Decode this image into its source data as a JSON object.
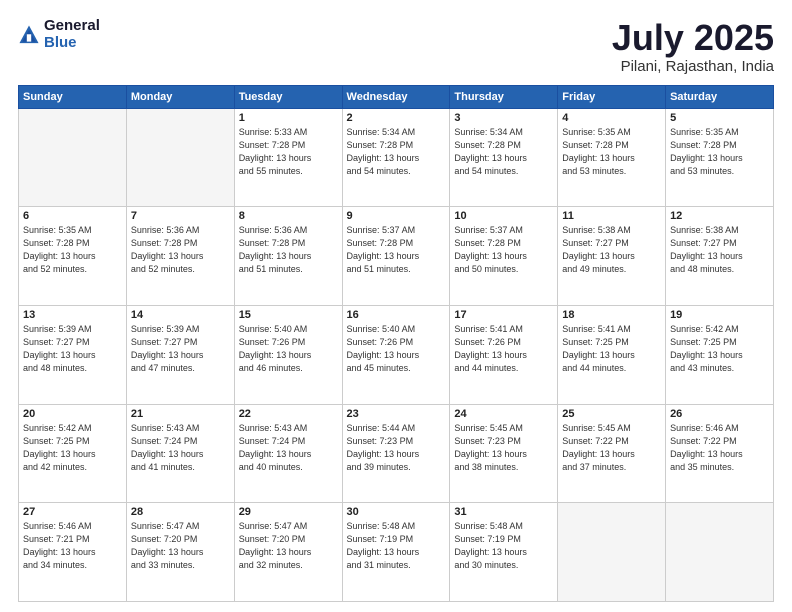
{
  "logo": {
    "general": "General",
    "blue": "Blue"
  },
  "title": {
    "month": "July 2025",
    "location": "Pilani, Rajasthan, India"
  },
  "headers": [
    "Sunday",
    "Monday",
    "Tuesday",
    "Wednesday",
    "Thursday",
    "Friday",
    "Saturday"
  ],
  "weeks": [
    [
      {
        "day": "",
        "detail": ""
      },
      {
        "day": "",
        "detail": ""
      },
      {
        "day": "1",
        "detail": "Sunrise: 5:33 AM\nSunset: 7:28 PM\nDaylight: 13 hours\nand 55 minutes."
      },
      {
        "day": "2",
        "detail": "Sunrise: 5:34 AM\nSunset: 7:28 PM\nDaylight: 13 hours\nand 54 minutes."
      },
      {
        "day": "3",
        "detail": "Sunrise: 5:34 AM\nSunset: 7:28 PM\nDaylight: 13 hours\nand 54 minutes."
      },
      {
        "day": "4",
        "detail": "Sunrise: 5:35 AM\nSunset: 7:28 PM\nDaylight: 13 hours\nand 53 minutes."
      },
      {
        "day": "5",
        "detail": "Sunrise: 5:35 AM\nSunset: 7:28 PM\nDaylight: 13 hours\nand 53 minutes."
      }
    ],
    [
      {
        "day": "6",
        "detail": "Sunrise: 5:35 AM\nSunset: 7:28 PM\nDaylight: 13 hours\nand 52 minutes."
      },
      {
        "day": "7",
        "detail": "Sunrise: 5:36 AM\nSunset: 7:28 PM\nDaylight: 13 hours\nand 52 minutes."
      },
      {
        "day": "8",
        "detail": "Sunrise: 5:36 AM\nSunset: 7:28 PM\nDaylight: 13 hours\nand 51 minutes."
      },
      {
        "day": "9",
        "detail": "Sunrise: 5:37 AM\nSunset: 7:28 PM\nDaylight: 13 hours\nand 51 minutes."
      },
      {
        "day": "10",
        "detail": "Sunrise: 5:37 AM\nSunset: 7:28 PM\nDaylight: 13 hours\nand 50 minutes."
      },
      {
        "day": "11",
        "detail": "Sunrise: 5:38 AM\nSunset: 7:27 PM\nDaylight: 13 hours\nand 49 minutes."
      },
      {
        "day": "12",
        "detail": "Sunrise: 5:38 AM\nSunset: 7:27 PM\nDaylight: 13 hours\nand 48 minutes."
      }
    ],
    [
      {
        "day": "13",
        "detail": "Sunrise: 5:39 AM\nSunset: 7:27 PM\nDaylight: 13 hours\nand 48 minutes."
      },
      {
        "day": "14",
        "detail": "Sunrise: 5:39 AM\nSunset: 7:27 PM\nDaylight: 13 hours\nand 47 minutes."
      },
      {
        "day": "15",
        "detail": "Sunrise: 5:40 AM\nSunset: 7:26 PM\nDaylight: 13 hours\nand 46 minutes."
      },
      {
        "day": "16",
        "detail": "Sunrise: 5:40 AM\nSunset: 7:26 PM\nDaylight: 13 hours\nand 45 minutes."
      },
      {
        "day": "17",
        "detail": "Sunrise: 5:41 AM\nSunset: 7:26 PM\nDaylight: 13 hours\nand 44 minutes."
      },
      {
        "day": "18",
        "detail": "Sunrise: 5:41 AM\nSunset: 7:25 PM\nDaylight: 13 hours\nand 44 minutes."
      },
      {
        "day": "19",
        "detail": "Sunrise: 5:42 AM\nSunset: 7:25 PM\nDaylight: 13 hours\nand 43 minutes."
      }
    ],
    [
      {
        "day": "20",
        "detail": "Sunrise: 5:42 AM\nSunset: 7:25 PM\nDaylight: 13 hours\nand 42 minutes."
      },
      {
        "day": "21",
        "detail": "Sunrise: 5:43 AM\nSunset: 7:24 PM\nDaylight: 13 hours\nand 41 minutes."
      },
      {
        "day": "22",
        "detail": "Sunrise: 5:43 AM\nSunset: 7:24 PM\nDaylight: 13 hours\nand 40 minutes."
      },
      {
        "day": "23",
        "detail": "Sunrise: 5:44 AM\nSunset: 7:23 PM\nDaylight: 13 hours\nand 39 minutes."
      },
      {
        "day": "24",
        "detail": "Sunrise: 5:45 AM\nSunset: 7:23 PM\nDaylight: 13 hours\nand 38 minutes."
      },
      {
        "day": "25",
        "detail": "Sunrise: 5:45 AM\nSunset: 7:22 PM\nDaylight: 13 hours\nand 37 minutes."
      },
      {
        "day": "26",
        "detail": "Sunrise: 5:46 AM\nSunset: 7:22 PM\nDaylight: 13 hours\nand 35 minutes."
      }
    ],
    [
      {
        "day": "27",
        "detail": "Sunrise: 5:46 AM\nSunset: 7:21 PM\nDaylight: 13 hours\nand 34 minutes."
      },
      {
        "day": "28",
        "detail": "Sunrise: 5:47 AM\nSunset: 7:20 PM\nDaylight: 13 hours\nand 33 minutes."
      },
      {
        "day": "29",
        "detail": "Sunrise: 5:47 AM\nSunset: 7:20 PM\nDaylight: 13 hours\nand 32 minutes."
      },
      {
        "day": "30",
        "detail": "Sunrise: 5:48 AM\nSunset: 7:19 PM\nDaylight: 13 hours\nand 31 minutes."
      },
      {
        "day": "31",
        "detail": "Sunrise: 5:48 AM\nSunset: 7:19 PM\nDaylight: 13 hours\nand 30 minutes."
      },
      {
        "day": "",
        "detail": ""
      },
      {
        "day": "",
        "detail": ""
      }
    ]
  ]
}
